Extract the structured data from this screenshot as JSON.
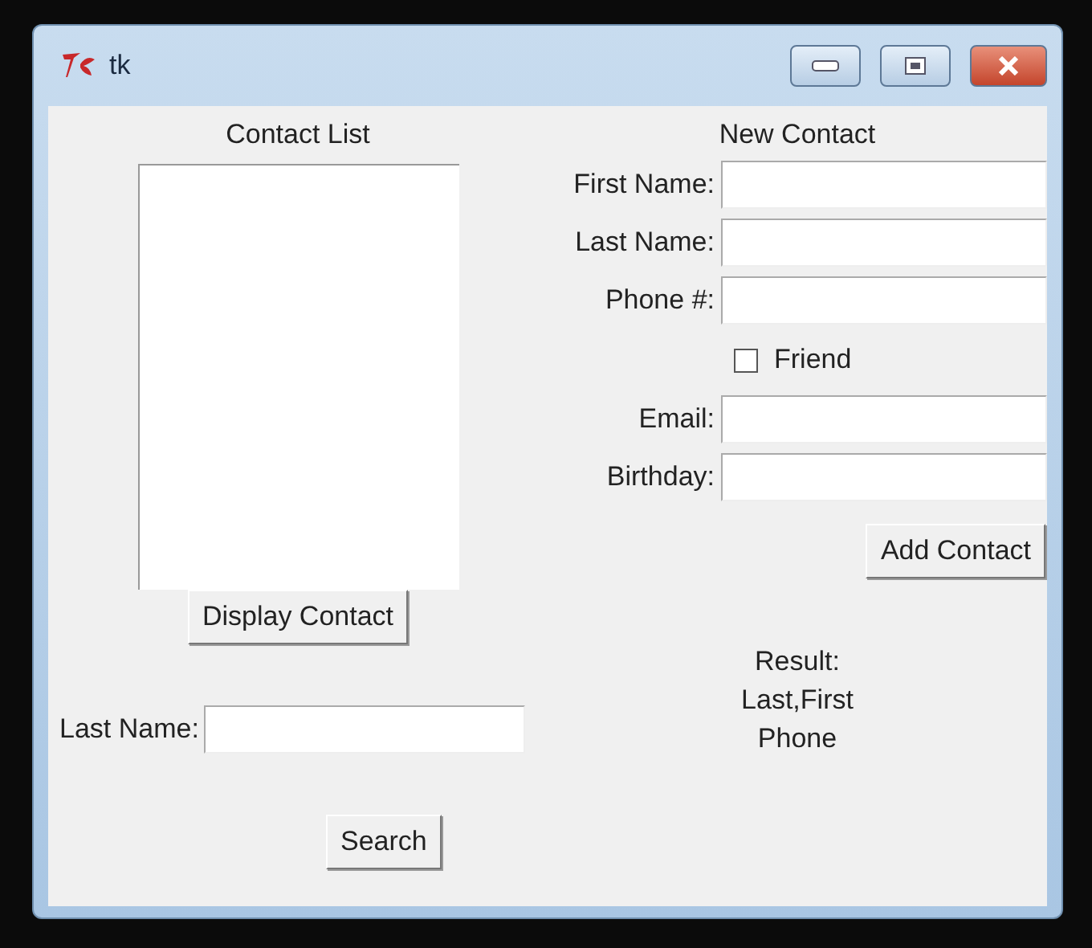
{
  "window": {
    "title": "tk"
  },
  "contact_list": {
    "heading": "Contact List",
    "button": "Display Contact"
  },
  "search": {
    "label": "Last Name:",
    "button": "Search"
  },
  "new_contact": {
    "heading": "New Contact",
    "fields": [
      {
        "kind": "entry",
        "label": "First Name:"
      },
      {
        "kind": "entry",
        "label": "Last Name:"
      },
      {
        "kind": "entry",
        "label": "Phone #:"
      },
      {
        "kind": "checkbox",
        "label": "Friend",
        "checked": false
      },
      {
        "kind": "entry",
        "label": "Email:"
      },
      {
        "kind": "entry",
        "label": "Birthday:"
      }
    ],
    "button": "Add Contact"
  },
  "result": {
    "text": "Result:\nLast,First\nPhone"
  }
}
